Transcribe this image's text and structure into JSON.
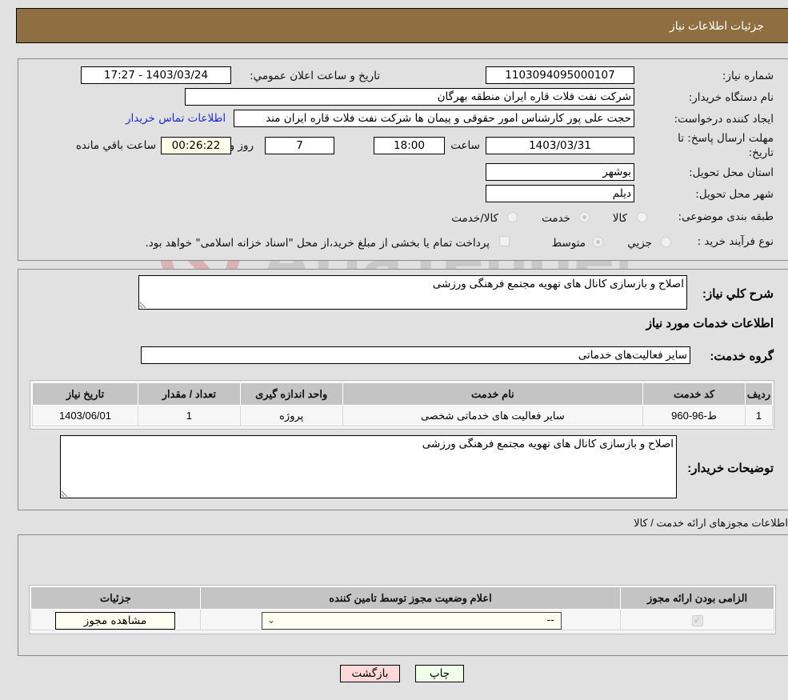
{
  "header": {
    "title": "جزئیات اطلاعات نیاز"
  },
  "details": {
    "need_number_label": "شماره نیاز:",
    "need_number": "1103094095000107",
    "announce_label": "تاریخ و ساعت اعلان عمومي:",
    "announce_value": "1403/03/24 - 17:27",
    "buyer_org_label": "نام دستگاه خريدار:",
    "buyer_org": "شرکت نفت فلات قاره ایران منطقه بهرگان",
    "requester_label": "ايجاد کننده درخواست:",
    "requester": "حجت علی پور کارشناس امور حقوقی و پیمان ها شرکت نفت فلات قاره ایران مند",
    "contact_link": "اطلاعات تماس خريدار",
    "deadline_label": "مهلت ارسال پاسخ: تا تاریخ:",
    "deadline_date": "1403/03/31",
    "time_label": "ساعت",
    "deadline_time": "18:00",
    "days": "7",
    "days_label": "روز و",
    "remaining_time": "00:26:22",
    "remaining_label": "ساعت باقي مانده",
    "province_label": "استان محل تحویل:",
    "province": "بوشهر",
    "city_label": "شهر محل تحویل:",
    "city": "دیلم",
    "category_label": "طبقه بندی موضوعی:",
    "category_options": [
      {
        "label": "کالا",
        "checked": false
      },
      {
        "label": "خدمت",
        "checked": true
      },
      {
        "label": "کالا/خدمت",
        "checked": false
      }
    ],
    "process_label": "نوع فرآيند خريد :",
    "process_options": [
      {
        "label": "جزيي",
        "checked": false
      },
      {
        "label": "متوسط",
        "checked": true
      }
    ],
    "treasury_checkbox_label": "پرداخت تمام یا بخشی از مبلغ خرید،از محل \"اسناد خزانه اسلامی\" خواهد بود.",
    "treasury_checked": false
  },
  "description": {
    "general_label": "شرح کلي نياز:",
    "general_value": "اصلاح و بازسازی کانال های تهویه مجتمع فرهنگی ورزشی",
    "services_heading": "اطلاعات خدمات مورد نياز",
    "service_group_label": "گروه خدمت:",
    "service_group_value": "سایر فعالیت‌های خدماتی"
  },
  "services_table": {
    "headers": [
      "ردیف",
      "کد خدمت",
      "نام خدمت",
      "واحد اندازه گیری",
      "تعداد / مقدار",
      "تاریخ نیاز"
    ],
    "rows": [
      [
        "1",
        "ط-96-960",
        "سایر فعالیت های خدماتی شخصی",
        "پروژه",
        "1",
        "1403/06/01"
      ]
    ]
  },
  "buyer_notes": {
    "label": "توضيحات خريدار:",
    "value": "اصلاح و بازسازی کانال های تهویه مجتمع فرهنگی ورزشی"
  },
  "licenses": {
    "heading": "اطلاعات مجوزهای ارائه خدمت / کالا",
    "headers": [
      "الزامی بودن ارائه مجوز",
      "اعلام وضعیت مجوز توسط تامین کننده",
      "جزئیات"
    ],
    "row": {
      "required_checked": true,
      "status_selected": "--",
      "details_button": "مشاهده مجوز"
    }
  },
  "actions": {
    "print": "چاپ",
    "back": "بازگشت"
  },
  "watermark": {
    "text": "AriaTender.neT"
  },
  "colors": {
    "header_bg": "#8f6e42",
    "link": "#1f2ccc",
    "print_bg": "#efffea",
    "back_bg": "#ffd9d9"
  }
}
